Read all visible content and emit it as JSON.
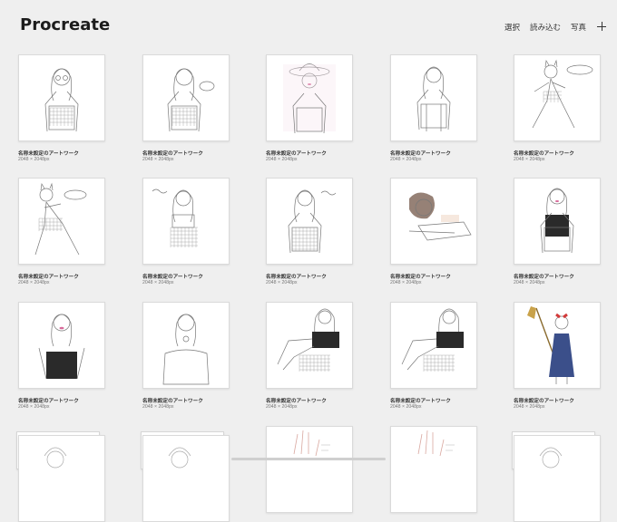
{
  "app": {
    "title": "Procreate"
  },
  "toolbar": {
    "select_label": "選択",
    "import_label": "読み込む",
    "photo_label": "写真",
    "new_icon": "plus-icon"
  },
  "gallery": {
    "artworks": [
      {
        "name": "名称未設定のアートワーク",
        "size": "2048 × 2048px",
        "subject": "woman with glasses, gingham top"
      },
      {
        "name": "名称未設定のアートワーク",
        "size": "2048 × 2048px",
        "subject": "woman in gingham top with speech bubble"
      },
      {
        "name": "名称未設定のアートワーク",
        "size": "2048 × 2048px",
        "subject": "woman in hat, pink tint"
      },
      {
        "name": "名称未設定のアートワーク",
        "size": "2048 × 2048px",
        "subject": "woman with braids, overalls"
      },
      {
        "name": "名称未設定のアートワーク",
        "size": "2048 × 2048px",
        "subject": "posing girl with cat ears"
      },
      {
        "name": "名称未設定のアートワーク",
        "size": "2048 × 2048px",
        "subject": "posing girl in checkered outfit"
      },
      {
        "name": "名称未設定のアートワーク",
        "size": "2048 × 2048px",
        "subject": "girl in crop top with handwritten text"
      },
      {
        "name": "名称未設定のアートワーク",
        "size": "2048 × 2048px",
        "subject": "girl in checkered dress with handwritten text"
      },
      {
        "name": "名称未設定のアートワーク",
        "size": "2048 × 2048px",
        "subject": "lying girl, bob haircut"
      },
      {
        "name": "名称未設定のアートワーク",
        "size": "2048 × 2048px",
        "subject": "long-haired woman, black top"
      },
      {
        "name": "名称未設定のアートワーク",
        "size": "2048 × 2048px",
        "subject": "long-haired woman, pink lips"
      },
      {
        "name": "名称未設定のアートワーク",
        "size": "2048 × 2048px",
        "subject": "long-haired woman, line art"
      },
      {
        "name": "名称未設定のアートワーク",
        "size": "2048 × 2048px",
        "subject": "sitting girl, plaid skirt"
      },
      {
        "name": "名称未設定のアートワーク",
        "size": "2048 × 2048px",
        "subject": "sitting girl, plaid skirt (copy)"
      },
      {
        "name": "名称未設定のアートワーク",
        "size": "2048 × 2048px",
        "subject": "witch girl with broom"
      }
    ],
    "partial_row": [
      {
        "kind": "stack",
        "subject": "stack of portraits"
      },
      {
        "kind": "stack",
        "subject": "stack of portraits"
      },
      {
        "kind": "single",
        "subject": "hands sketch"
      },
      {
        "kind": "single",
        "subject": "hands sketch"
      },
      {
        "kind": "stack",
        "subject": "stack of portraits"
      }
    ]
  },
  "colors": {
    "background": "#efefef",
    "lips": "#d86a9a",
    "dress": "#3b4f8a",
    "bow": "#d23a3a",
    "top": "#2a2a2a"
  }
}
